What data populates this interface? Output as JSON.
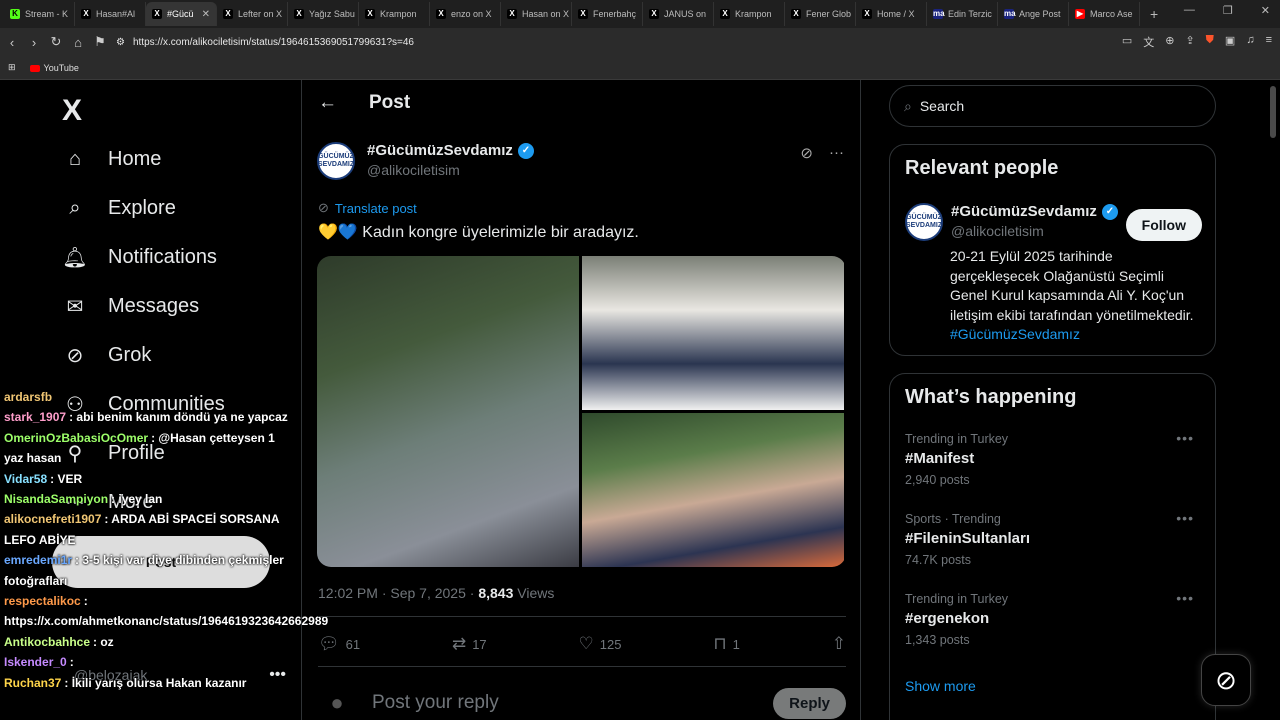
{
  "browser": {
    "tabs": [
      {
        "label": "Stream - K",
        "fav": "K",
        "color": "#53fc18"
      },
      {
        "label": "Hasan#Al",
        "fav": "X",
        "color": "#000000"
      },
      {
        "label": "#Gücü",
        "fav": "X",
        "color": "#000000",
        "active": true
      },
      {
        "label": "Lefter on X",
        "fav": "X",
        "color": "#000000"
      },
      {
        "label": "Yağız Sabu",
        "fav": "X",
        "color": "#000000"
      },
      {
        "label": "Krampon",
        "fav": "X",
        "color": "#000000"
      },
      {
        "label": "enzo on X",
        "fav": "X",
        "color": "#000000"
      },
      {
        "label": "Hasan on X",
        "fav": "X",
        "color": "#000000"
      },
      {
        "label": "Fenerbahç",
        "fav": "X",
        "color": "#000000"
      },
      {
        "label": "JANUS on",
        "fav": "X",
        "color": "#000000"
      },
      {
        "label": "Krampon",
        "fav": "X",
        "color": "#000000"
      },
      {
        "label": "Fener Glob",
        "fav": "X",
        "color": "#000000"
      },
      {
        "label": "Home / X",
        "fav": "X",
        "color": "#000000"
      },
      {
        "label": "Edin Terzic",
        "fav": "ma",
        "color": "#1a237e"
      },
      {
        "label": "Ange Post",
        "fav": "ma",
        "color": "#1a237e"
      },
      {
        "label": "Marco Ase",
        "fav": "▶",
        "color": "#ff0000"
      }
    ],
    "url": "https://x.com/alikociletisim/status/1964615369051799631?s=46",
    "bookmark": "YouTube"
  },
  "nav": {
    "logo": "X",
    "items": [
      {
        "label": "Home",
        "icon": "home-icon"
      },
      {
        "label": "Explore",
        "icon": "search-icon"
      },
      {
        "label": "Notifications",
        "icon": "bell-icon"
      },
      {
        "label": "Messages",
        "icon": "mail-icon"
      },
      {
        "label": "Grok",
        "icon": "grok-icon"
      },
      {
        "label": "Communities",
        "icon": "communities-icon"
      },
      {
        "label": "Profile",
        "icon": "profile-icon"
      },
      {
        "label": "More",
        "icon": "more-icon"
      }
    ],
    "post_button": "Post",
    "me_handle": "@belozajak"
  },
  "chat": [
    {
      "user": "ardarsfb",
      "color": "#f0c674",
      "msg": ""
    },
    {
      "user": "stark_1907",
      "color": "#ff9ecb",
      "msg": ": abi benim kanım döndü ya ne yapcaz"
    },
    {
      "user": "OmerinOzBabasiOcOmer",
      "color": "#9dff6a",
      "msg": ": @Hasan çetteysen 1 yaz hasan"
    },
    {
      "user": "Vidar58",
      "color": "#88e0ff",
      "msg": ": VER"
    },
    {
      "user": "NisandaSampiyon",
      "color": "#9dff6a",
      "msg": ": iyey lan"
    },
    {
      "user": "alikocnefreti1907",
      "color": "#f0c674",
      "msg": ": ARDA ABİ SPACEİ SORSANA LEFO ABİYE"
    },
    {
      "user": "emredemi1r",
      "color": "#6aa8ff",
      "msg": ": 3-5 kişi var diye dibinden çekmişler fotoğrafları"
    },
    {
      "user": "respectalikoc",
      "color": "#ff9a4a",
      "msg": ": https://x.com/ahmetkonanc/status/1964619323642662989"
    },
    {
      "user": "Antikocbahhce",
      "color": "#c9ff8a",
      "msg": ": oz"
    },
    {
      "user": "Iskender_0",
      "color": "#c58aff",
      "msg": ":"
    },
    {
      "user": "Ruchan37",
      "color": "#ffd54a",
      "msg": ": İkili yarış olursa Hakan kazanır"
    }
  ],
  "main": {
    "header": "Post",
    "author_name": "#GücümüzSevdamız",
    "author_handle": "@alikociletisim",
    "avatar_text": "GÜCÜMÜZ SEVDAMIZ",
    "translate": "Translate post",
    "text": "💛💙 Kadın kongre üyelerimizle bir aradayız.",
    "time": "12:02 PM · Sep 7, 2025 · ",
    "views_count": "8,843",
    "views_label": " Views",
    "stats": {
      "replies": "61",
      "reposts": "17",
      "likes": "125",
      "bookmarks": "1"
    },
    "reply_placeholder": "Post your reply",
    "reply_button": "Reply"
  },
  "right": {
    "search_placeholder": "Search",
    "relevant_title": "Relevant people",
    "rp_name": "#GücümüzSevdamız",
    "rp_handle": "@alikociletisim",
    "follow": "Follow",
    "bio": "20-21 Eylül 2025 tarihinde gerçekleşecek Olağanüstü Seçimli Genel Kurul kapsamında Ali Y. Koç'un iletişim ekibi tarafından yönetilmektedir. ",
    "bio_tag": "#GücümüzSevdamız",
    "happening_title": "What’s happening",
    "trends": [
      {
        "context": "Trending in Turkey",
        "name": "#Manifest",
        "count": "2,940 posts"
      },
      {
        "context": "Sports · Trending",
        "name": "#FileninSultanları",
        "count": "74.7K posts"
      },
      {
        "context": "Trending in Turkey",
        "name": "#ergenekon",
        "count": "1,343 posts"
      }
    ],
    "show_more": "Show more"
  }
}
